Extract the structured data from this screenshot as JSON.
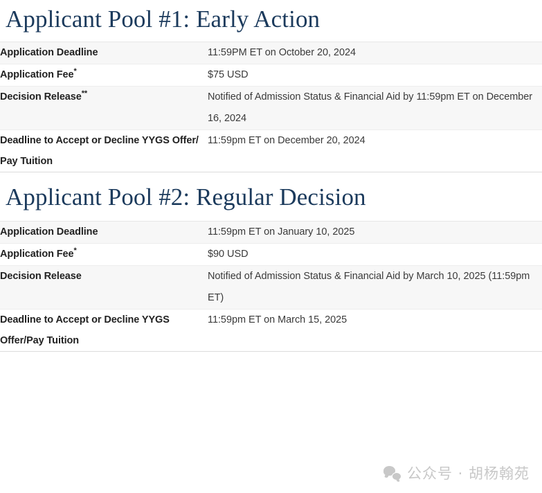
{
  "sections": [
    {
      "heading": "Applicant Pool #1: Early Action",
      "rows": [
        {
          "label": "Application Deadline",
          "label_asterisk": "",
          "value": "11:59PM ET on October 20, 2024"
        },
        {
          "label": "Application Fee",
          "label_asterisk": "*",
          "value": "$75 USD"
        },
        {
          "label": "Decision Release",
          "label_asterisk": "**",
          "value": "Notified of Admission Status & Financial Aid by 11:59pm ET on December 16, 2024"
        },
        {
          "label": "Deadline to Accept or Decline YYGS Offer/ Pay Tuition",
          "label_asterisk": "",
          "value": "11:59pm ET on December 20, 2024"
        }
      ]
    },
    {
      "heading": "Applicant Pool #2: Regular Decision",
      "rows": [
        {
          "label": "Application Deadline",
          "label_asterisk": "",
          "value": "11:59pm ET on January 10, 2025"
        },
        {
          "label": "Application Fee",
          "label_asterisk": "*",
          "value": "$90 USD"
        },
        {
          "label": "Decision Release",
          "label_asterisk": "",
          "value": "Notified of Admission Status & Financial Aid by March 10, 2025 (11:59pm ET)"
        },
        {
          "label": "Deadline to Accept or Decline YYGS Offer/Pay Tuition",
          "label_asterisk": "",
          "value": "11:59pm ET on March 15, 2025"
        }
      ]
    }
  ],
  "watermark": {
    "icon": "wechat-icon",
    "text": "公众号 · 胡杨翰苑"
  },
  "colors": {
    "heading": "#1b3a5c",
    "label_text": "#222222",
    "value_text": "#3a3a3a",
    "row_shaded": "#f7f7f7",
    "row_plain": "#ffffff",
    "border": "#e0e0e0",
    "watermark": "#c8c8c8"
  }
}
